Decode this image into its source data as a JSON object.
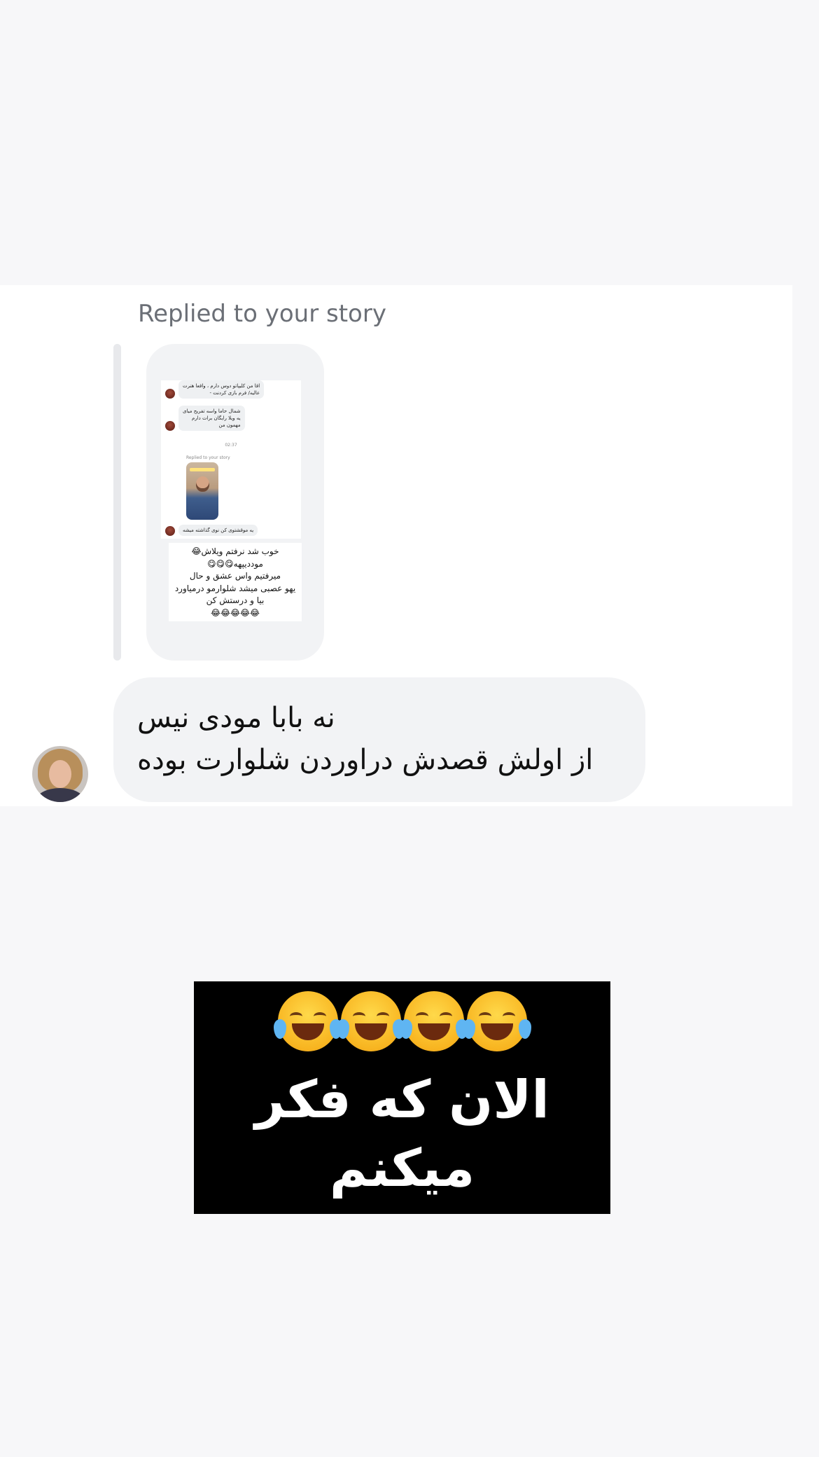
{
  "thread": {
    "reply_label": "Replied to your story",
    "story_screenshot": {
      "messages": [
        "اقا من کلیپاتو دوس دارم ، واقعا هنرت\nعالیه/ فرم بازی کردنت -",
        "شمال حاما واسه تفریح میای\nیه ویلا رایگان برات دارم\nمهمون من"
      ],
      "time": "02:37",
      "replied_label": "Replied to your story",
      "last_message": "یه موقشتوی کن نوی گذاشته میشه",
      "caption_text": "خوب شد نرفتم ویلاش😂\nموددیپهه😋😋😋\nمیرفتیم واس عشق و حال\nیهو عصبی میشد شلوارمو درمیاورد\nبیا و درستش کن\n😂😂😂😂😂"
    },
    "message": {
      "line1": "نه بابا مودی نیس",
      "line2": "از اولش قصدش دراوردن شلوارت بوده"
    },
    "avatar_icon": "user-avatar"
  },
  "image_message": {
    "emoji_icons": [
      "tears-of-joy-icon",
      "tears-of-joy-icon",
      "tears-of-joy-icon",
      "tears-of-joy-icon"
    ],
    "caption": "الان که فکر میکنم\nدور از ذهن نیس"
  }
}
